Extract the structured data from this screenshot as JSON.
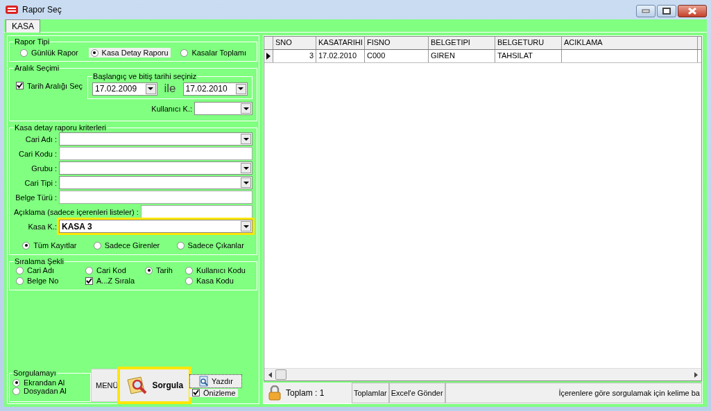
{
  "window": {
    "title": "Rapor Seç"
  },
  "tabs": [
    {
      "label": "KASA",
      "selected": true
    }
  ],
  "report_type": {
    "legend": "Rapor Tipi",
    "options": [
      {
        "label": "Günlük Rapor",
        "selected": false
      },
      {
        "label": "Kasa Detay Raporu",
        "selected": true
      },
      {
        "label": "Kasalar Toplamı",
        "selected": false
      }
    ]
  },
  "range": {
    "legend": "Aralık Seçimi",
    "checkbox": {
      "label": "Tarih Aralığı Seç",
      "checked": true
    },
    "dates": {
      "legend": "Başlangıç ve bitiş tarihi seçiniz",
      "start": "17.02.2009",
      "connector": "ile",
      "end": "17.02.2010"
    },
    "user_label": "Kullanıcı K.:"
  },
  "criteria": {
    "legend": "Kasa detay raporu kriterleri",
    "fields": [
      {
        "label": "Cari Adı :",
        "kind": "combo",
        "highlighted": false
      },
      {
        "label": "Cari Kodu :",
        "kind": "text",
        "highlighted": false
      },
      {
        "label": "Grubu :",
        "kind": "combo",
        "highlighted": false
      },
      {
        "label": "Cari Tipi :",
        "kind": "combo",
        "highlighted": false
      },
      {
        "label": "Belge Türü :",
        "kind": "text",
        "highlighted": false
      },
      {
        "label": "Açıklama (sadece içerenleri listeler) :",
        "kind": "text",
        "highlighted": false
      },
      {
        "label": "Kasa K.:",
        "kind": "combo",
        "value": "KASA 3",
        "highlighted": true
      }
    ],
    "filters": [
      {
        "label": "Tüm Kayıtlar",
        "selected": true
      },
      {
        "label": "Sadece Girenler",
        "selected": false
      },
      {
        "label": "Sadece Çıkanlar",
        "selected": false
      }
    ]
  },
  "sorting": {
    "legend": "Sıralama Şekli",
    "options": [
      {
        "label": "Cari Adı",
        "kind": "radio",
        "selected": false
      },
      {
        "label": "Cari Kod",
        "kind": "radio",
        "selected": false
      },
      {
        "label": "Tarih",
        "kind": "radio",
        "selected": true
      },
      {
        "label": "Kullanıcı Kodu",
        "kind": "radio",
        "selected": false
      },
      {
        "label": "Belge No",
        "kind": "radio",
        "selected": false
      },
      {
        "label": "A...Z Sırala",
        "kind": "checkbox",
        "selected": true
      },
      {
        "label": "Kasa Kodu",
        "kind": "radio",
        "selected": false
      }
    ]
  },
  "query_source": {
    "legend": "Sorgulamayı",
    "options": [
      {
        "label": "Ekrandan Al",
        "selected": true
      },
      {
        "label": "Dosyadan Al",
        "selected": false
      }
    ]
  },
  "actions": {
    "menu": "MENÜ",
    "query": {
      "label": "Sorgula",
      "highlighted": true
    },
    "print": "Yazdır",
    "preview": {
      "label": "Önizleme",
      "checked": true
    }
  },
  "grid": {
    "columns": [
      "SNO",
      "KASATARIHI",
      "FISNO",
      "BELGETIPI",
      "BELGETURU",
      "ACIKLAMA"
    ],
    "rows": [
      {
        "selected": true,
        "cells": [
          "3",
          "17.02.2010",
          "C000",
          "GIREN",
          "TAHSILAT",
          ""
        ]
      }
    ]
  },
  "status_bar": {
    "total": "Toplam : 1",
    "totals_button": "Toplamlar",
    "excel_button": "Excel'e Gönder",
    "hint": "İçerenlere göre sorgulamak için kelime ba"
  }
}
